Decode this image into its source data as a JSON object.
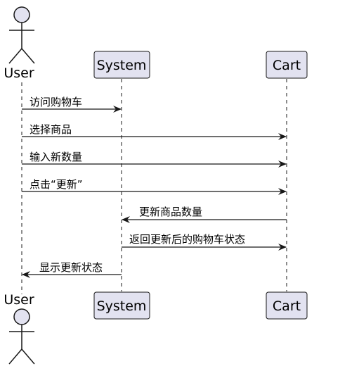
{
  "colors": {
    "participant_fill": "#e2e2f0",
    "participant_stroke": "#181818",
    "line": "#181818",
    "background": "#ffffff"
  },
  "participants": {
    "user": {
      "label": "User",
      "icon": "actor-stick-figure-icon"
    },
    "system": {
      "label": "System"
    },
    "cart": {
      "label": "Cart"
    }
  },
  "messages": [
    {
      "from": "user",
      "to": "system",
      "label": "访问购物车"
    },
    {
      "from": "user",
      "to": "cart",
      "label": "选择商品"
    },
    {
      "from": "user",
      "to": "cart",
      "label": "输入新数量"
    },
    {
      "from": "user",
      "to": "cart",
      "label": "点击“更新”"
    },
    {
      "from": "cart",
      "to": "system",
      "label": "更新商品数量"
    },
    {
      "from": "system",
      "to": "cart",
      "label": "返回更新后的购物车状态"
    },
    {
      "from": "system",
      "to": "user",
      "label": "显示更新状态"
    }
  ]
}
